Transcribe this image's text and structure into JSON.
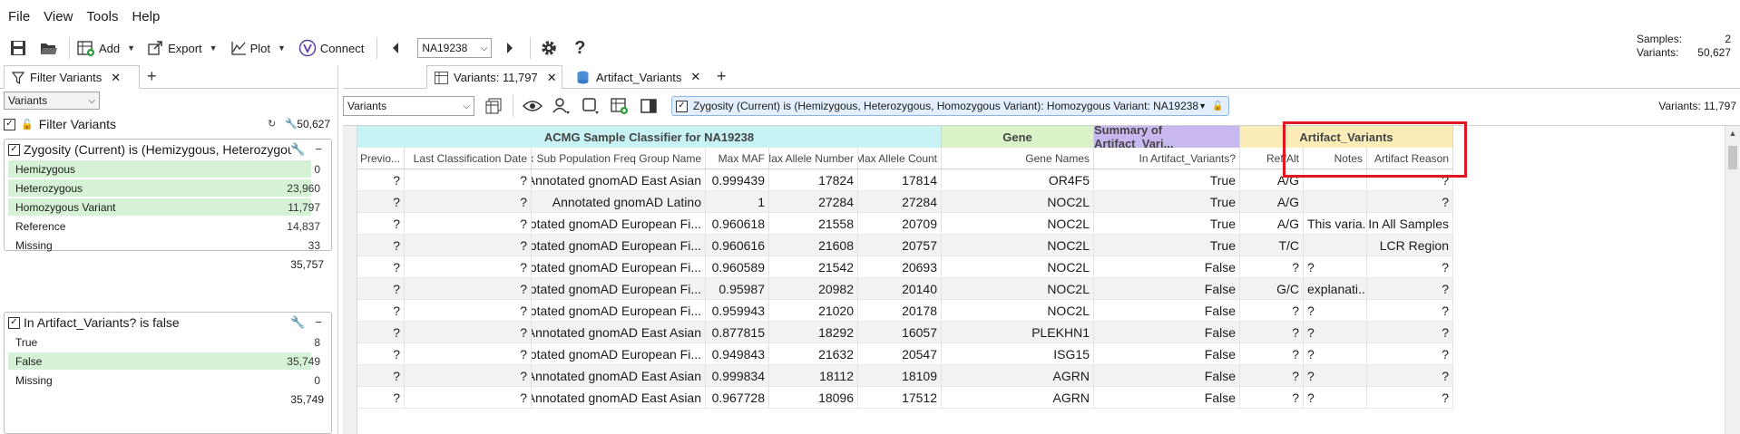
{
  "menu": [
    "File",
    "View",
    "Tools",
    "Help"
  ],
  "toolbar": {
    "add": "Add",
    "export": "Export",
    "plot": "Plot",
    "connect": "Connect",
    "sample": "NA19238"
  },
  "stats": {
    "samples_label": "Samples:",
    "samples_value": "2",
    "variants_label": "Variants:",
    "variants_value": "50,627"
  },
  "left_panel": {
    "tab_label": "Filter Variants",
    "select_value": "Variants",
    "filter_root_label": "Filter Variants",
    "filter_root_count": "50,627",
    "card1": {
      "title": "Zygosity (Current) is (Hemizygous, Heterozygous, Homozygous Variant)",
      "options": [
        {
          "label": "Hemizygous",
          "count": "0",
          "selected": true,
          "fill": 1.0
        },
        {
          "label": "Heterozygous",
          "count": "23,960",
          "selected": true,
          "fill": 1.0
        },
        {
          "label": "Homozygous Variant",
          "count": "11,797",
          "selected": true,
          "fill": 1.0
        },
        {
          "label": "Reference",
          "count": "14,837",
          "selected": false,
          "fill": 0
        },
        {
          "label": "Missing",
          "count": "33",
          "selected": false,
          "fill": 0
        }
      ],
      "total": "35,757"
    },
    "card2": {
      "title": "In Artifact_Variants? is false",
      "options": [
        {
          "label": "True",
          "count": "8",
          "selected": false,
          "fill": 0
        },
        {
          "label": "False",
          "count": "35,749",
          "selected": true,
          "fill": 1.0
        },
        {
          "label": "Missing",
          "count": "0",
          "selected": false,
          "fill": 0
        }
      ],
      "total": "35,749"
    }
  },
  "right_tabs": [
    {
      "label": "Variants: 11,797",
      "active": true
    },
    {
      "label": "Artifact_Variants",
      "active": false
    }
  ],
  "filterbar": {
    "select_value": "Variants",
    "chip_text": "Zygosity (Current) is (Hemizygous, Heterozygous, Homozygous Variant): Homozygous Variant: NA19238",
    "variants_count": "Variants: 11,797"
  },
  "table": {
    "groups": [
      {
        "label": "ACMG Sample Classifier for NA19238",
        "color": "#c7f3f5"
      },
      {
        "label": "Gene",
        "color": "#d9f2c8"
      },
      {
        "label": "Summary of Artifact_Vari...",
        "color": "#c9b8f0"
      },
      {
        "label": "Artifact_Variants",
        "color": "#fbedb8"
      }
    ],
    "columns": [
      "Previo...",
      "Last Classification Date",
      "Max Sub Population Freq Group Name",
      "Max MAF",
      "Max Allele Number",
      "Max Allele Count",
      "Gene Names",
      "In Artifact_Variants?",
      "Ref/Alt",
      "Notes",
      "Artifact Reason"
    ],
    "rows": [
      [
        "?",
        "?",
        "Annotated gnomAD East Asian",
        "0.999439",
        "17824",
        "17814",
        "OR4F5",
        "True",
        "A/G",
        "",
        "?"
      ],
      [
        "?",
        "?",
        "Annotated gnomAD Latino",
        "1",
        "27284",
        "27284",
        "NOC2L",
        "True",
        "A/G",
        "",
        "?"
      ],
      [
        "?",
        "?",
        "Annotated gnomAD European Fi...",
        "0.960618",
        "21558",
        "20709",
        "NOC2L",
        "True",
        "A/G",
        "This varia...",
        "In All Samples"
      ],
      [
        "?",
        "?",
        "Annotated gnomAD European Fi...",
        "0.960616",
        "21608",
        "20757",
        "NOC2L",
        "True",
        "T/C",
        "",
        "LCR Region"
      ],
      [
        "?",
        "?",
        "Annotated gnomAD European Fi...",
        "0.960589",
        "21542",
        "20693",
        "NOC2L",
        "False",
        "?",
        "?",
        "?"
      ],
      [
        "?",
        "?",
        "Annotated gnomAD European Fi...",
        "0.95987",
        "20982",
        "20140",
        "NOC2L",
        "False",
        "G/C",
        "explanati...",
        "?"
      ],
      [
        "?",
        "?",
        "Annotated gnomAD European Fi...",
        "0.959943",
        "21020",
        "20178",
        "NOC2L",
        "False",
        "?",
        "?",
        "?"
      ],
      [
        "?",
        "?",
        "Annotated gnomAD East Asian",
        "0.877815",
        "18292",
        "16057",
        "PLEKHN1",
        "False",
        "?",
        "?",
        "?"
      ],
      [
        "?",
        "?",
        "Annotated gnomAD European Fi...",
        "0.949843",
        "21632",
        "20547",
        "ISG15",
        "False",
        "?",
        "?",
        "?"
      ],
      [
        "?",
        "?",
        "Annotated gnomAD East Asian",
        "0.999834",
        "18112",
        "18109",
        "AGRN",
        "False",
        "?",
        "?",
        "?"
      ],
      [
        "?",
        "?",
        "Annotated gnomAD East Asian",
        "0.967728",
        "18096",
        "17512",
        "AGRN",
        "False",
        "?",
        "?",
        "?"
      ]
    ]
  }
}
